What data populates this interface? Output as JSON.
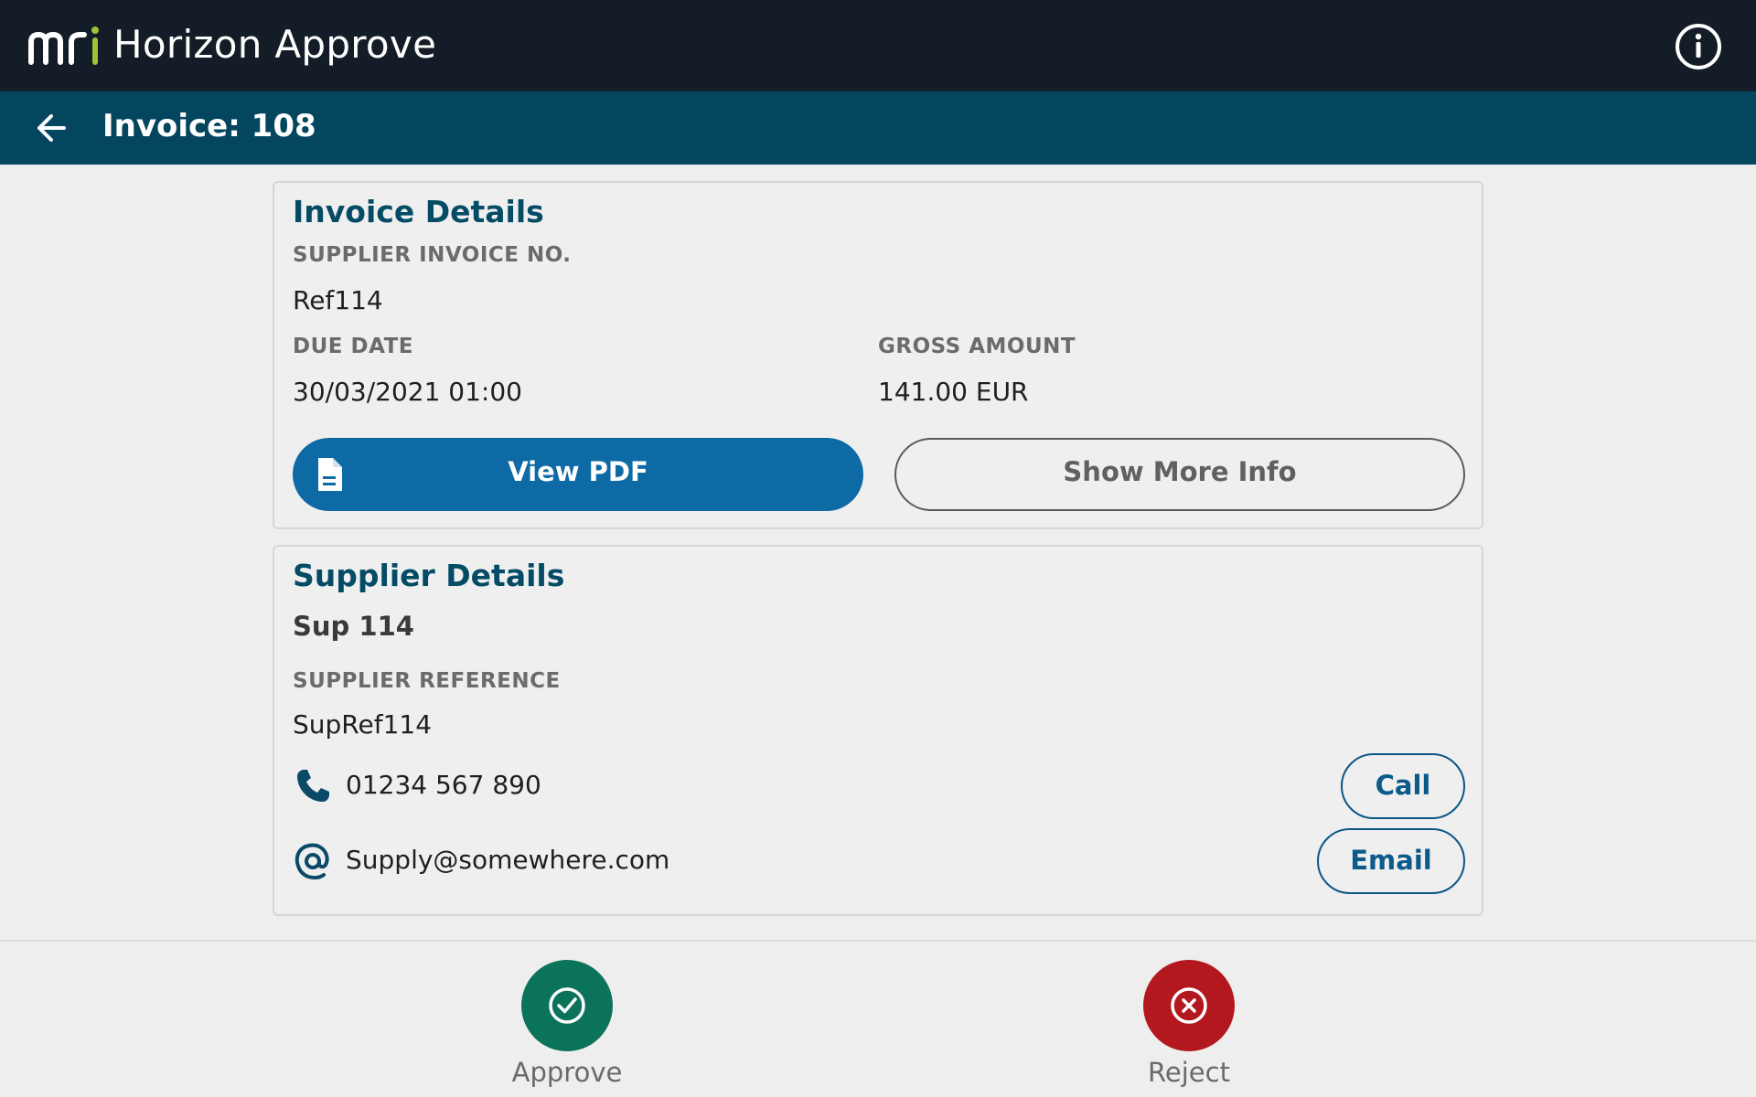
{
  "app": {
    "title": "Horizon Approve",
    "logo_text": "mri",
    "info_icon": "info-circle-icon"
  },
  "subheader": {
    "back_icon": "arrow-left-icon",
    "title": "Invoice: 108"
  },
  "invoice_details": {
    "title": "Invoice Details",
    "supplier_invoice_label": "SUPPLIER INVOICE NO.",
    "supplier_invoice_value": "Ref114",
    "due_date_label": "DUE DATE",
    "due_date_value": "30/03/2021 01:00",
    "gross_amount_label": "GROSS AMOUNT",
    "gross_amount_value": "141.00 EUR",
    "view_pdf_label": "View PDF",
    "show_more_label": "Show More Info"
  },
  "supplier_details": {
    "title": "Supplier Details",
    "name": "Sup 114",
    "reference_label": "SUPPLIER REFERENCE",
    "reference_value": "SupRef114",
    "phone": "01234 567 890",
    "email": "Supply@somewhere.com",
    "call_label": "Call",
    "email_label": "Email"
  },
  "actions": {
    "approve_label": "Approve",
    "reject_label": "Reject"
  },
  "colors": {
    "topbar": "#141d27",
    "subbar": "#04465e",
    "primary": "#0d6aa5",
    "title_text": "#044b66",
    "approve": "#0b7359",
    "reject": "#b3181f",
    "logo_accent": "#9bc43c"
  }
}
